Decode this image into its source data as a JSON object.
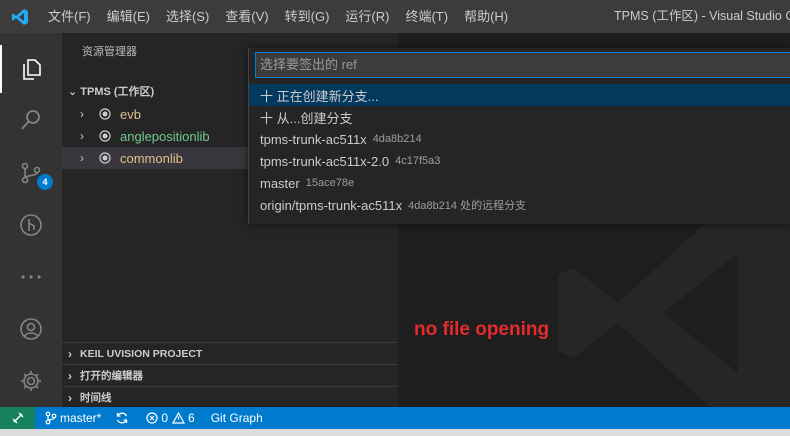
{
  "titlebar": {
    "menu": [
      "文件(F)",
      "编辑(E)",
      "选择(S)",
      "查看(V)",
      "转到(G)",
      "运行(R)",
      "终端(T)",
      "帮助(H)"
    ],
    "window_title": "TPMS (工作区) - Visual Studio Co"
  },
  "activity": {
    "scm_badge": "4"
  },
  "sidebar": {
    "title": "资源管理器",
    "workspace": "TPMS (工作区)",
    "folders": [
      {
        "label": "evb",
        "color": "#e2c08d"
      },
      {
        "label": "anglepositionlib",
        "color": "#73c991"
      },
      {
        "label": "commonlib",
        "color": "#e2c08d"
      }
    ],
    "sections": [
      "KEIL UVISION PROJECT",
      "打开的编辑器",
      "时间线"
    ]
  },
  "quickpick": {
    "placeholder": "选择要签出的 ref",
    "items": [
      {
        "label": "十 正在创建新分支...",
        "desc": ""
      },
      {
        "label": "十 从...创建分支",
        "desc": ""
      },
      {
        "label": "tpms-trunk-ac511x",
        "desc": "4da8b214"
      },
      {
        "label": "tpms-trunk-ac511x-2.0",
        "desc": "4c17f5a3"
      },
      {
        "label": "master",
        "desc": "15ace78e"
      },
      {
        "label": "origin/tpms-trunk-ac511x",
        "desc": "4da8b214 处的远程分支"
      }
    ]
  },
  "editor": {
    "annotation": "no file opening"
  },
  "statusbar": {
    "branch": "master*",
    "errors": "0",
    "warnings": "6",
    "git_graph": "Git Graph"
  },
  "colors": {
    "accent": "#007acc",
    "remote": "#16825d",
    "annotation": "#e52b2b"
  }
}
